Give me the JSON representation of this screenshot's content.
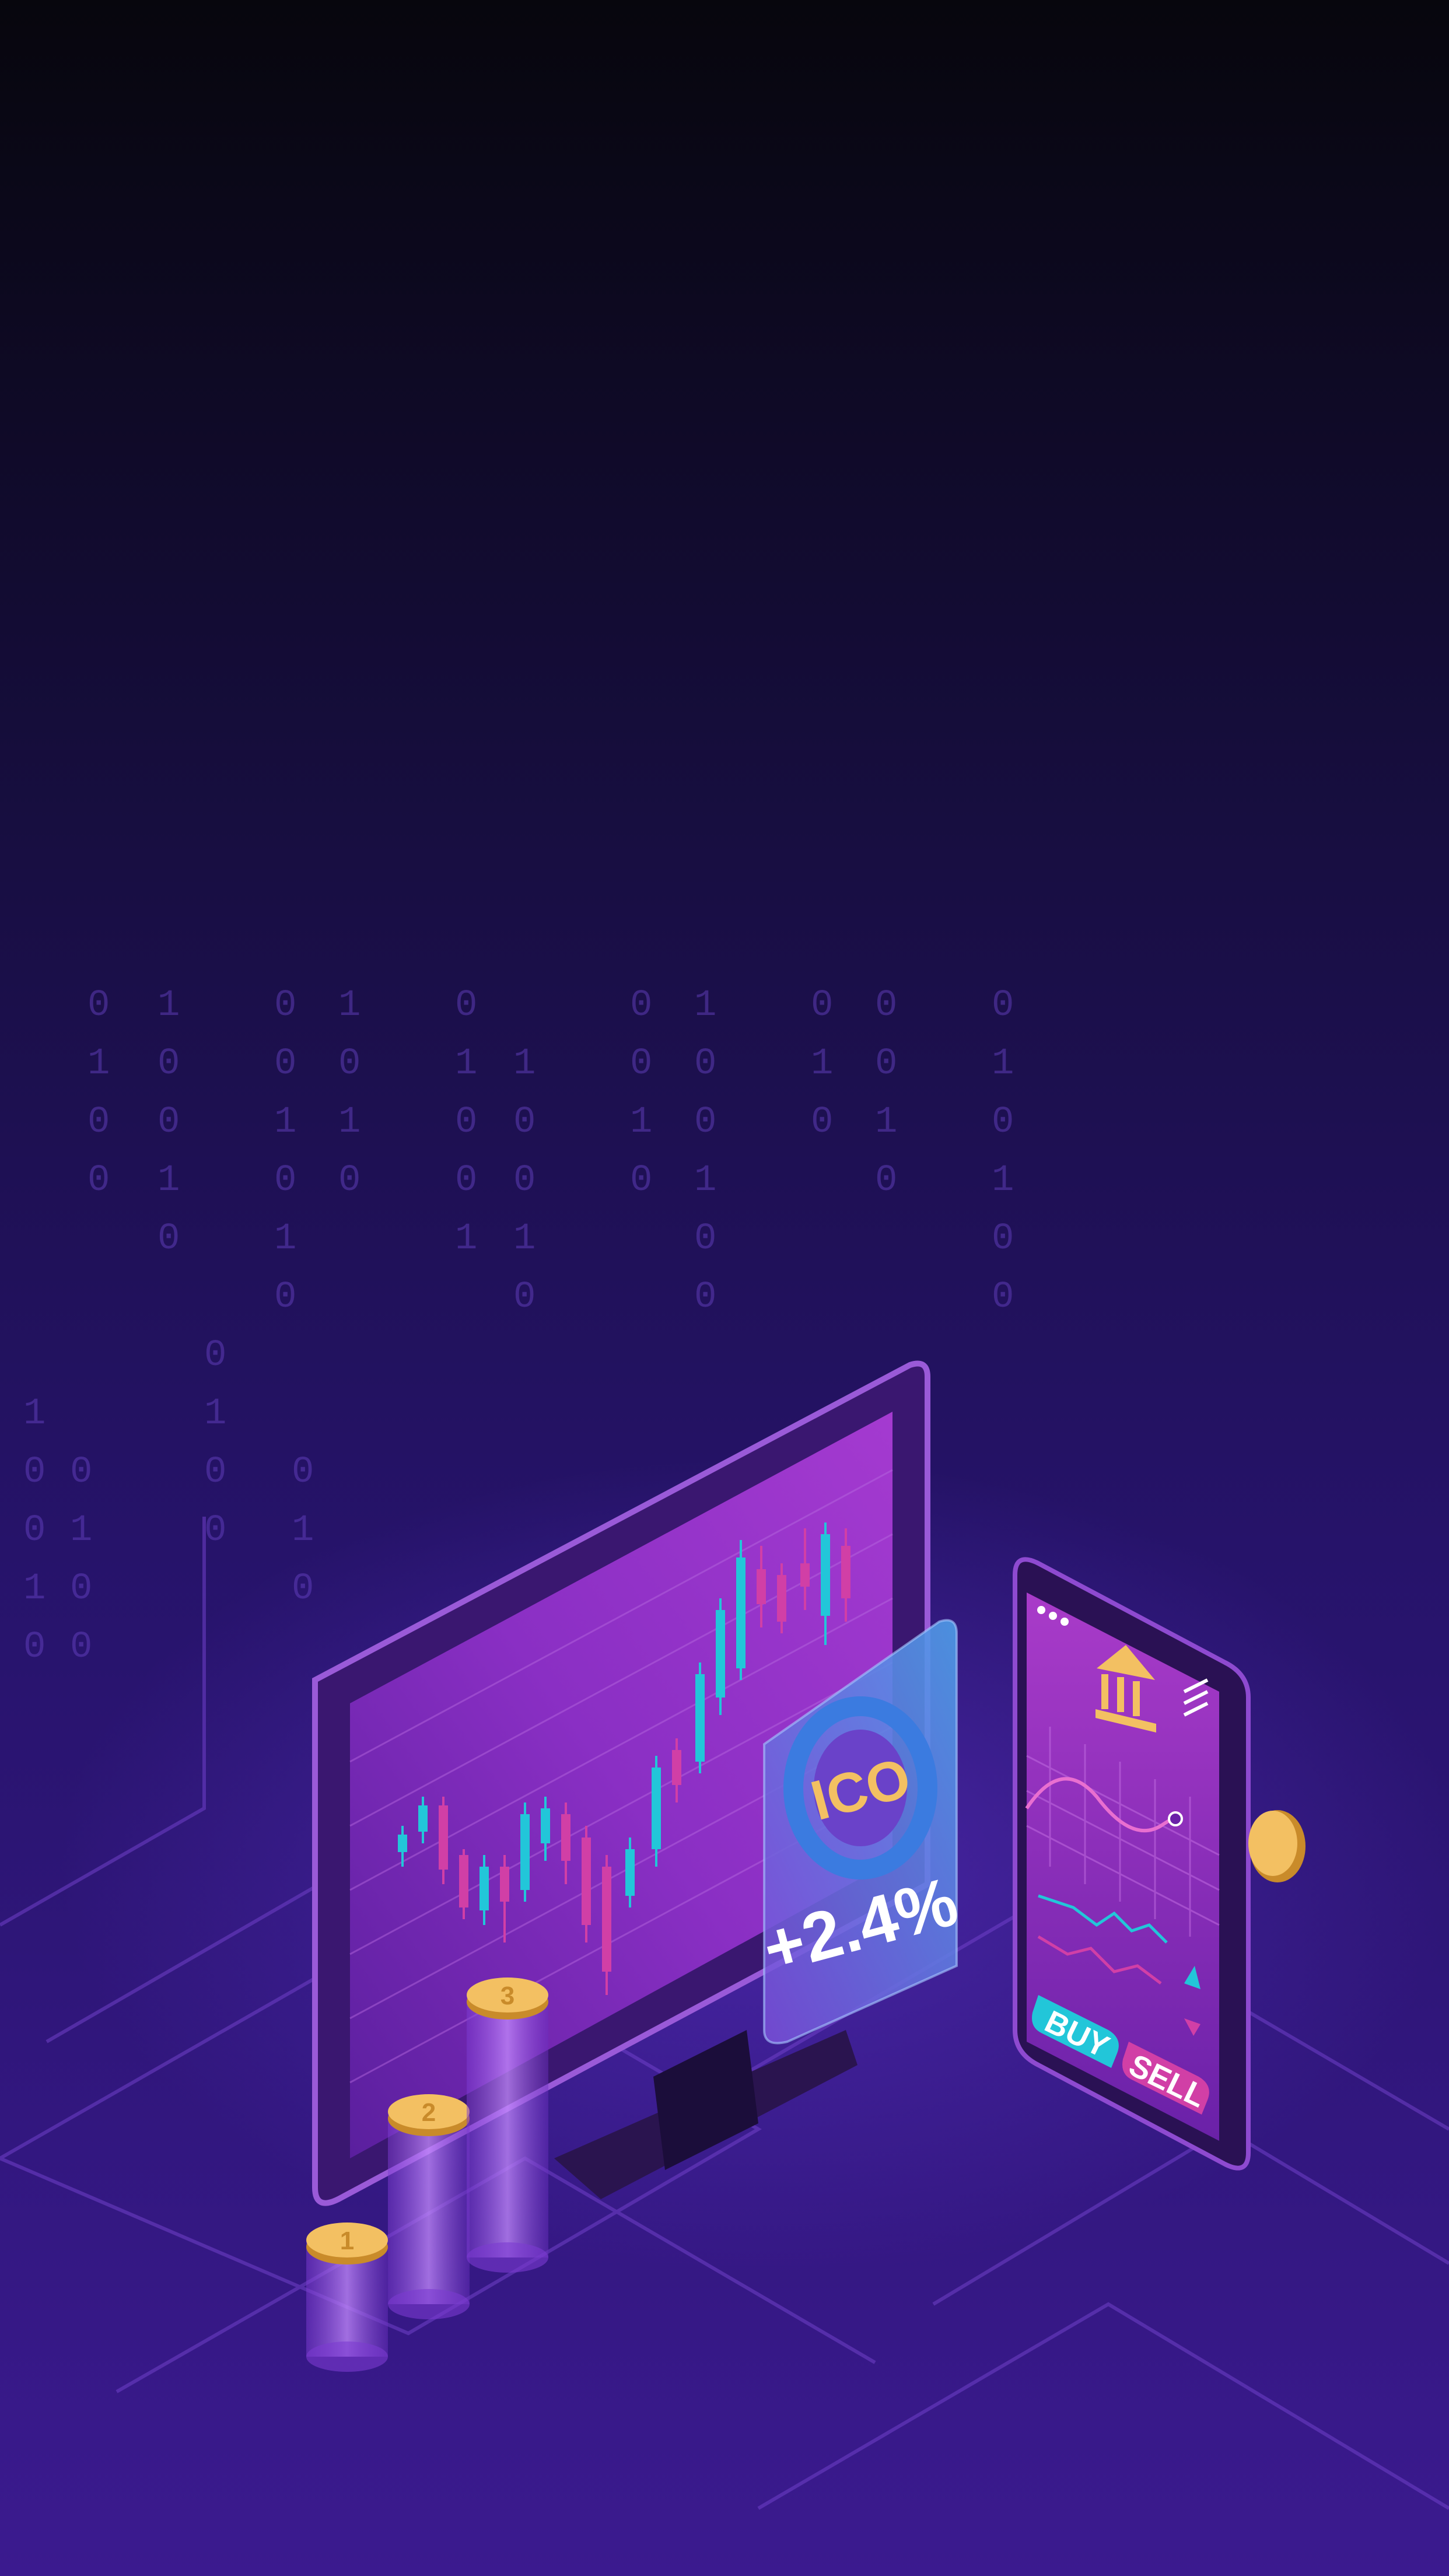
{
  "illustration": {
    "badge": {
      "label": "ICO",
      "change": "+2.4%"
    },
    "phone": {
      "buy_label": "BUY",
      "sell_label": "SELL"
    },
    "coins": {
      "stack_1": "1",
      "stack_2": "2",
      "stack_3": "3"
    }
  },
  "colors": {
    "bg_top": "#07060d",
    "bg_bottom": "#3b1a8f",
    "accent_cyan": "#22c6d9",
    "accent_magenta": "#d13fa6",
    "accent_gold": "#f3c062",
    "screen_purple": "#8a2fc4"
  }
}
